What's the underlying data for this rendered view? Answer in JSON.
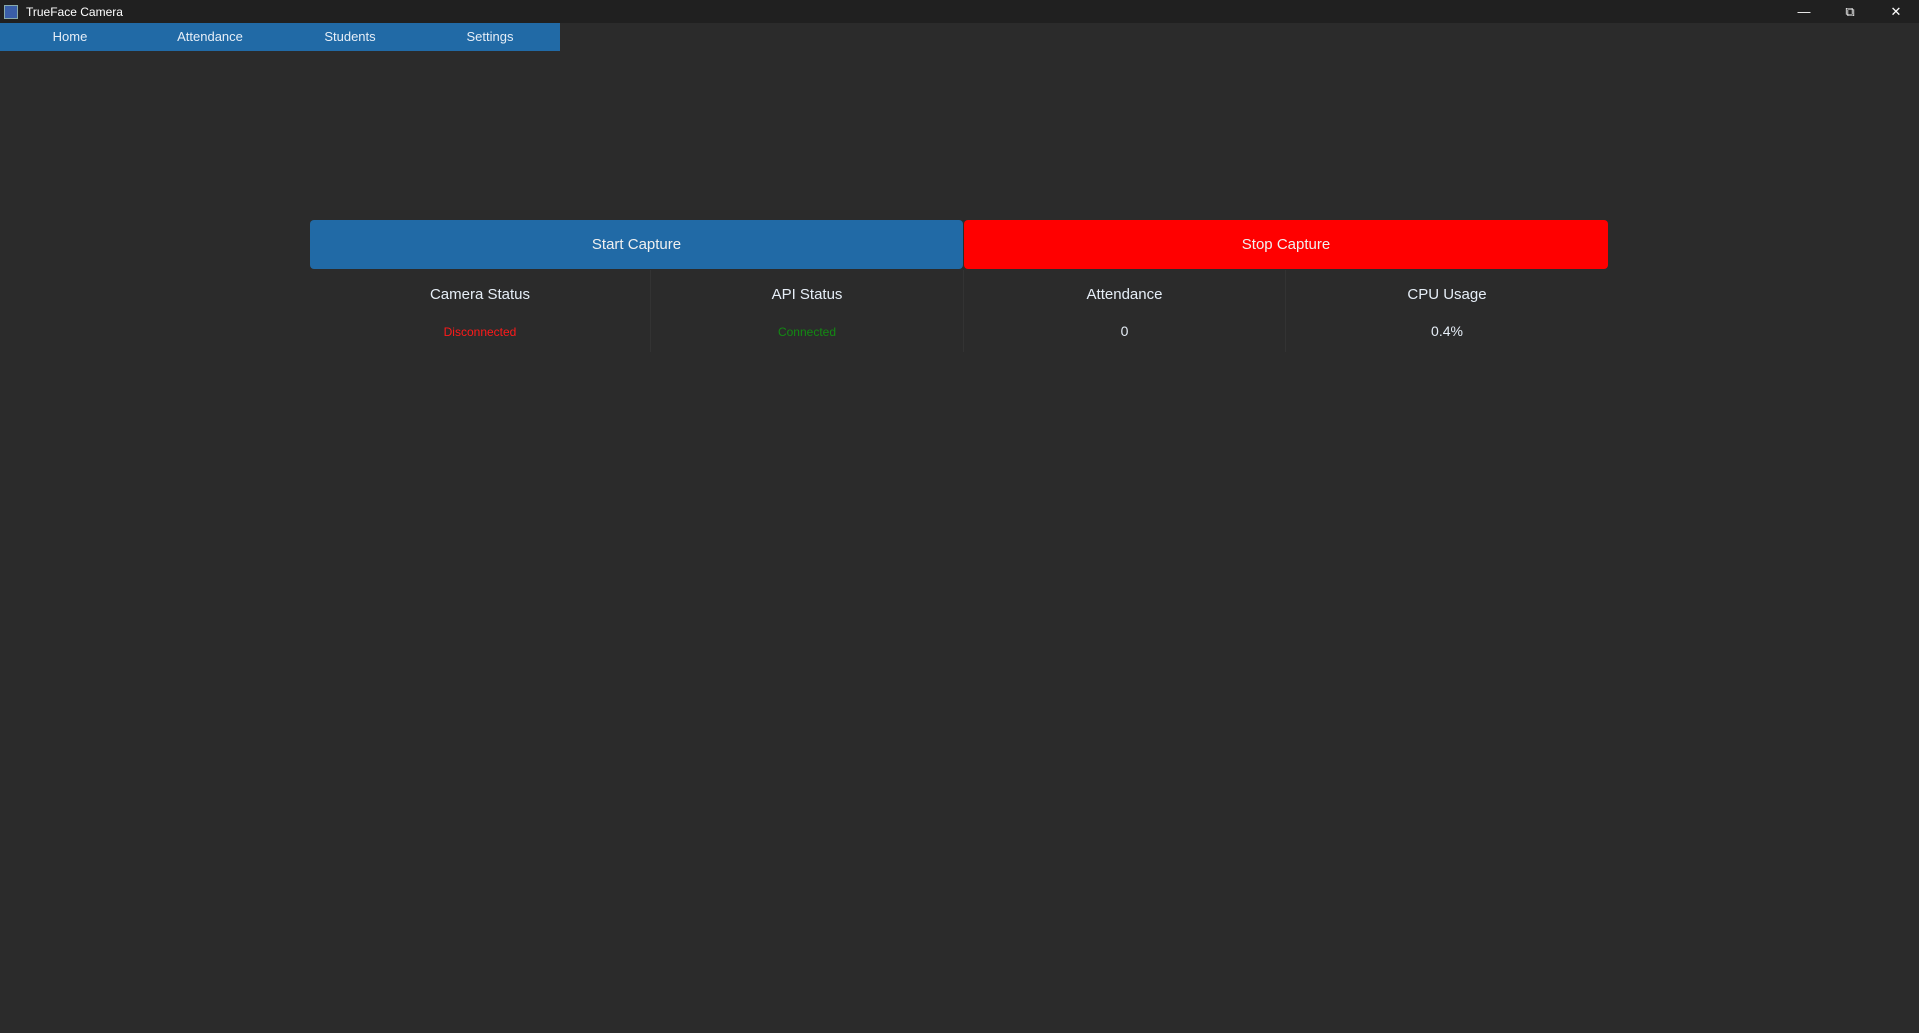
{
  "window": {
    "title": "TrueFace Camera"
  },
  "nav": {
    "items": [
      "Home",
      "Attendance",
      "Students",
      "Settings"
    ]
  },
  "actions": {
    "start": "Start Capture",
    "stop": "Stop Capture"
  },
  "stats": [
    {
      "label": "Camera Status",
      "value": "Disconnected",
      "color": "#ff1a1a"
    },
    {
      "label": "API Status",
      "value": "Connected",
      "color": "#138a13"
    },
    {
      "label": "Attendance",
      "value": "0"
    },
    {
      "label": "CPU Usage",
      "value": "0.4%"
    }
  ],
  "colors": {
    "accent": "#216aa6",
    "danger": "#ff0000",
    "background": "#2b2b2b"
  }
}
